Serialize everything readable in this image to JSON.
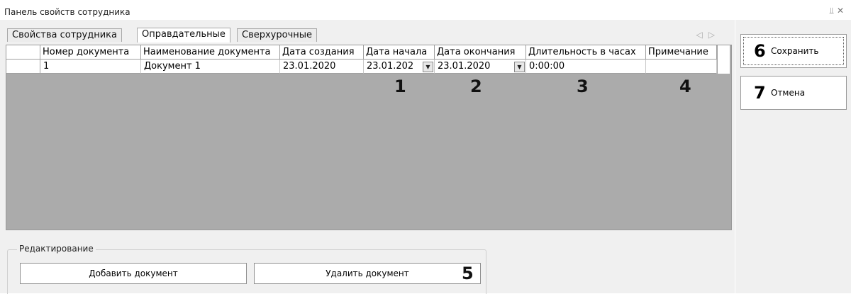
{
  "panel": {
    "title": "Панель свойств сотрудника",
    "icons": [
      "pin-icon",
      "close-icon"
    ]
  },
  "tabs": [
    {
      "label": "Свойства сотрудника",
      "active": false
    },
    {
      "label": "Оправдательные",
      "active": true
    },
    {
      "label": "Сверхурочные",
      "active": false
    }
  ],
  "grid": {
    "columns": [
      "Номер документа",
      "Наименование документа",
      "Дата создания",
      "Дата начала",
      "Дата окончания",
      "Длительность в часах",
      "Примечание"
    ],
    "rows": [
      {
        "number": "1",
        "name": "Документ 1",
        "created": "23.01.2020",
        "start": "23.01.202",
        "end": "23.01.2020",
        "duration": "0:00:00",
        "note": ""
      }
    ]
  },
  "callouts": [
    "1",
    "2",
    "3",
    "4",
    "5",
    "6",
    "7"
  ],
  "side_buttons": {
    "save_label": "Сохранить",
    "cancel_label": "Отмена"
  },
  "editing": {
    "group_label": "Редактирование",
    "add_label": "Добавить документ",
    "delete_label": "Удалить документ"
  }
}
